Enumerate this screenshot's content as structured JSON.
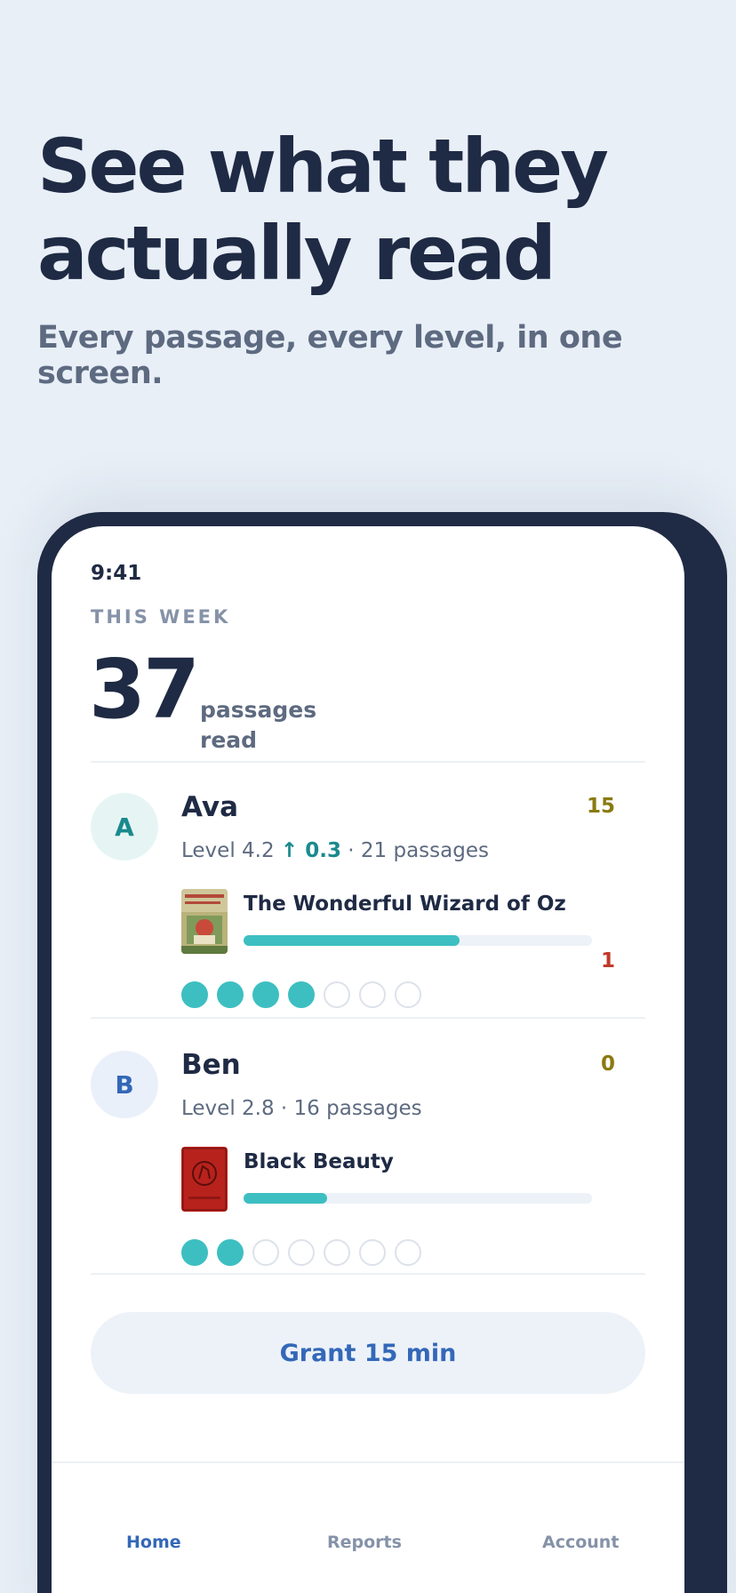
{
  "hero": {
    "title_line1": "See what they",
    "title_line2": "actually read",
    "subtitle": "Every passage, every level, in one screen."
  },
  "status_bar": {
    "time": "9:41"
  },
  "summary": {
    "period_label": "THIS WEEK",
    "count": "37",
    "count_label_line1": "passages",
    "count_label_line2": "read"
  },
  "kids": [
    {
      "initial": "A",
      "name": "Ava",
      "level_text": "Level 4.2 ",
      "delta_arrow": "↑ ",
      "delta": "0.3",
      "passages_text": " · 21 passages",
      "score_top": "15",
      "score_bottom": "1",
      "book_title": "The Wonderful Wizard of Oz",
      "book_progress": 0.62,
      "days_done": 4,
      "days_total": 7
    },
    {
      "initial": "B",
      "name": "Ben",
      "level_text": "Level 2.8",
      "passages_text": " · 16 passages",
      "score_top": "0",
      "book_title": "Black Beauty",
      "book_progress": 0.24,
      "days_done": 2,
      "days_total": 7
    }
  ],
  "actions": {
    "grant_label": "Grant 15 min"
  },
  "tabs": [
    {
      "label": "Home",
      "active": true
    },
    {
      "label": "Reports",
      "active": false
    },
    {
      "label": "Account",
      "active": false
    }
  ],
  "colors": {
    "accent": "#3368b8",
    "teal": "#3dbfc1",
    "navy": "#1f2a44",
    "score_gold": "#8a7a10",
    "score_red": "#c0392b"
  }
}
